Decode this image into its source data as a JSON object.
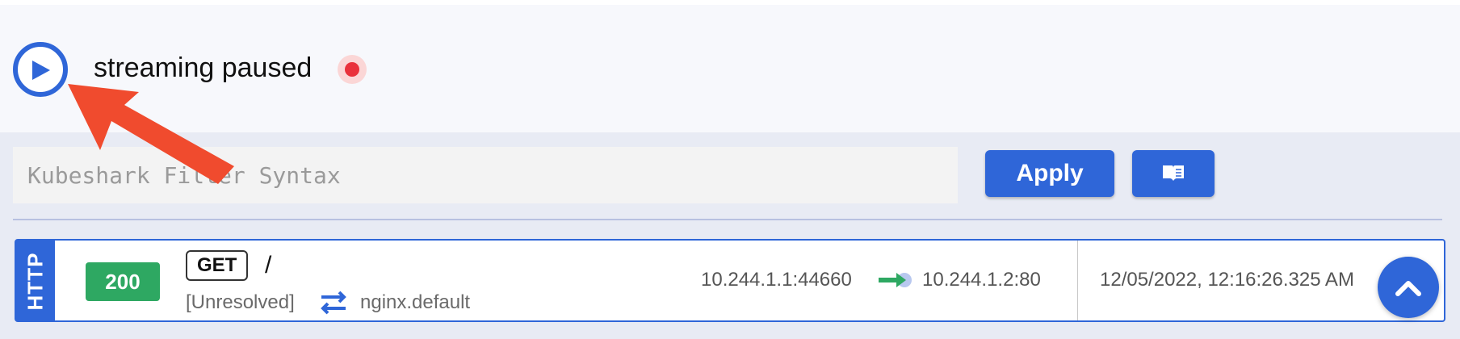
{
  "header": {
    "status_text": "streaming paused",
    "play_icon": "play-icon",
    "recording_icon": "recording-indicator-icon"
  },
  "filter": {
    "placeholder": "Kubeshark Filter Syntax",
    "value": "",
    "apply_label": "Apply",
    "docs_icon": "book-open-icon"
  },
  "entries": [
    {
      "protocol": "HTTP",
      "status_code": "200",
      "method": "GET",
      "path": "/",
      "source_name": "[Unresolved]",
      "destination_name": "nginx.default",
      "source_ip": "10.244.1.1:44660",
      "destination_ip": "10.244.1.2:80",
      "timestamp": "12/05/2022, 12:16:26.325 AM"
    }
  ],
  "colors": {
    "accent": "#2f66d8",
    "success": "#2ea862",
    "recording": "#e9313b",
    "annotation_arrow": "#f04b2e"
  }
}
